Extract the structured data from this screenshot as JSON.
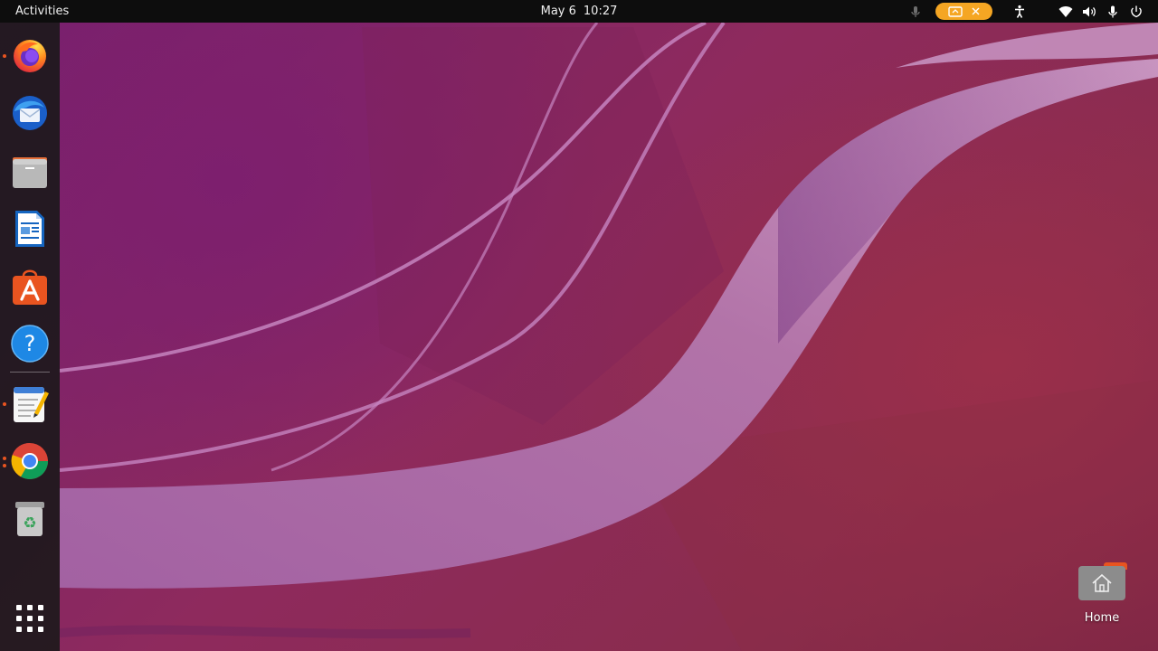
{
  "topbar": {
    "activities_label": "Activities",
    "date": "May 6",
    "time": "10:27",
    "tray_icons": [
      "microphone-muted-icon",
      "screen-recording-indicator",
      "accessibility-icon",
      "wifi-icon",
      "volume-icon",
      "microphone-icon",
      "power-icon"
    ]
  },
  "dock": {
    "items": [
      {
        "name": "firefox",
        "icon": "firefox-icon",
        "running": true
      },
      {
        "name": "thunderbird",
        "icon": "thunderbird-icon",
        "running": false
      },
      {
        "name": "files",
        "icon": "files-icon",
        "running": false
      },
      {
        "name": "libreoffice-writer",
        "icon": "libreoffice-writer-icon",
        "running": false
      },
      {
        "name": "ubuntu-software",
        "icon": "software-center-icon",
        "running": false
      },
      {
        "name": "help",
        "icon": "help-icon",
        "running": false
      },
      {
        "name": "text-editor",
        "icon": "text-editor-icon",
        "running": true
      },
      {
        "name": "chrome",
        "icon": "chrome-icon",
        "running": true
      },
      {
        "name": "trash",
        "icon": "trash-icon",
        "running": false
      }
    ],
    "show_apps_icon": "app-grid-icon"
  },
  "desktop": {
    "icons": [
      {
        "label": "Home",
        "icon": "home-folder-icon"
      }
    ]
  },
  "colors": {
    "accent": "#e95420",
    "recording_pill": "#f5a623",
    "topbar": "#0d0d0d"
  }
}
